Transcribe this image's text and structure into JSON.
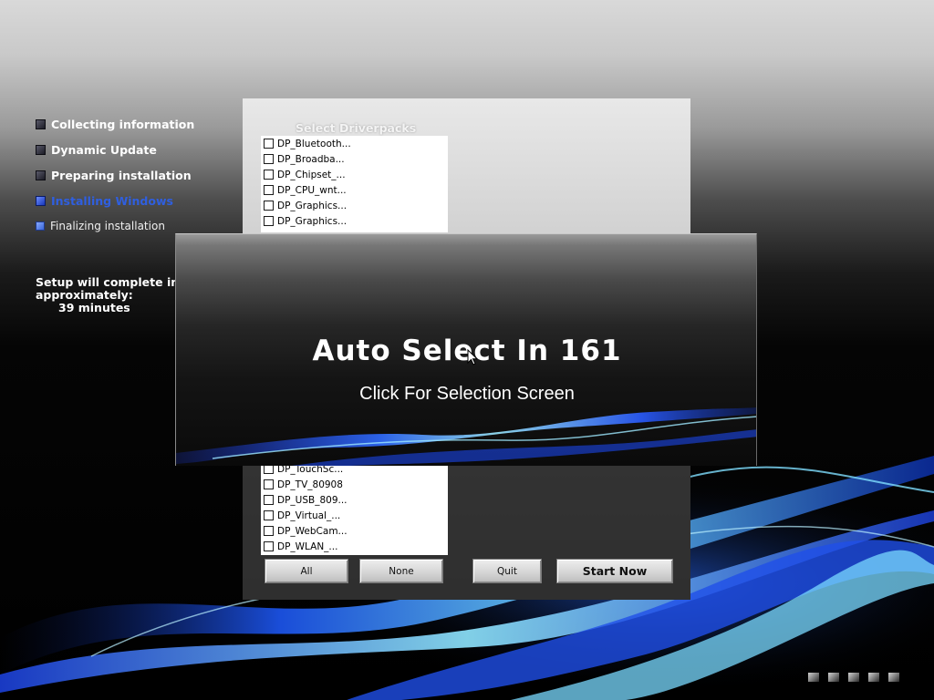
{
  "setup_steps": [
    {
      "label": "Collecting information",
      "state": "done"
    },
    {
      "label": "Dynamic Update",
      "state": "done"
    },
    {
      "label": "Preparing installation",
      "state": "done"
    },
    {
      "label": "Installing Windows",
      "state": "active"
    },
    {
      "label": "Finalizing installation",
      "state": "pending"
    }
  ],
  "time_remaining": {
    "line1": "Setup will complete in",
    "line2": "approximately:",
    "minutes": "39 minutes"
  },
  "driverpacks": {
    "title": "Select Driverpacks",
    "list_top": [
      "DP_Bluetooth...",
      "DP_Broadba...",
      "DP_Chipset_...",
      "DP_CPU_wnt...",
      "DP_Graphics...",
      "DP_Graphics..."
    ],
    "list_bottom": [
      "DP_TouchSc...",
      "DP_TV_80908",
      "DP_USB_809...",
      "DP_Virtual_...",
      "DP_WebCam...",
      "DP_WLAN_..."
    ],
    "buttons": {
      "all": "All",
      "none": "None",
      "quit": "Quit",
      "start": "Start Now"
    }
  },
  "overlay": {
    "auto_select": "Auto Select In 161",
    "click_text": "Click For Selection Screen"
  },
  "colors": {
    "active_step": "#2f5fe0",
    "wave_blue": "#1e5bff",
    "wave_cyan": "#6fd8ff"
  },
  "progress_squares": 5
}
